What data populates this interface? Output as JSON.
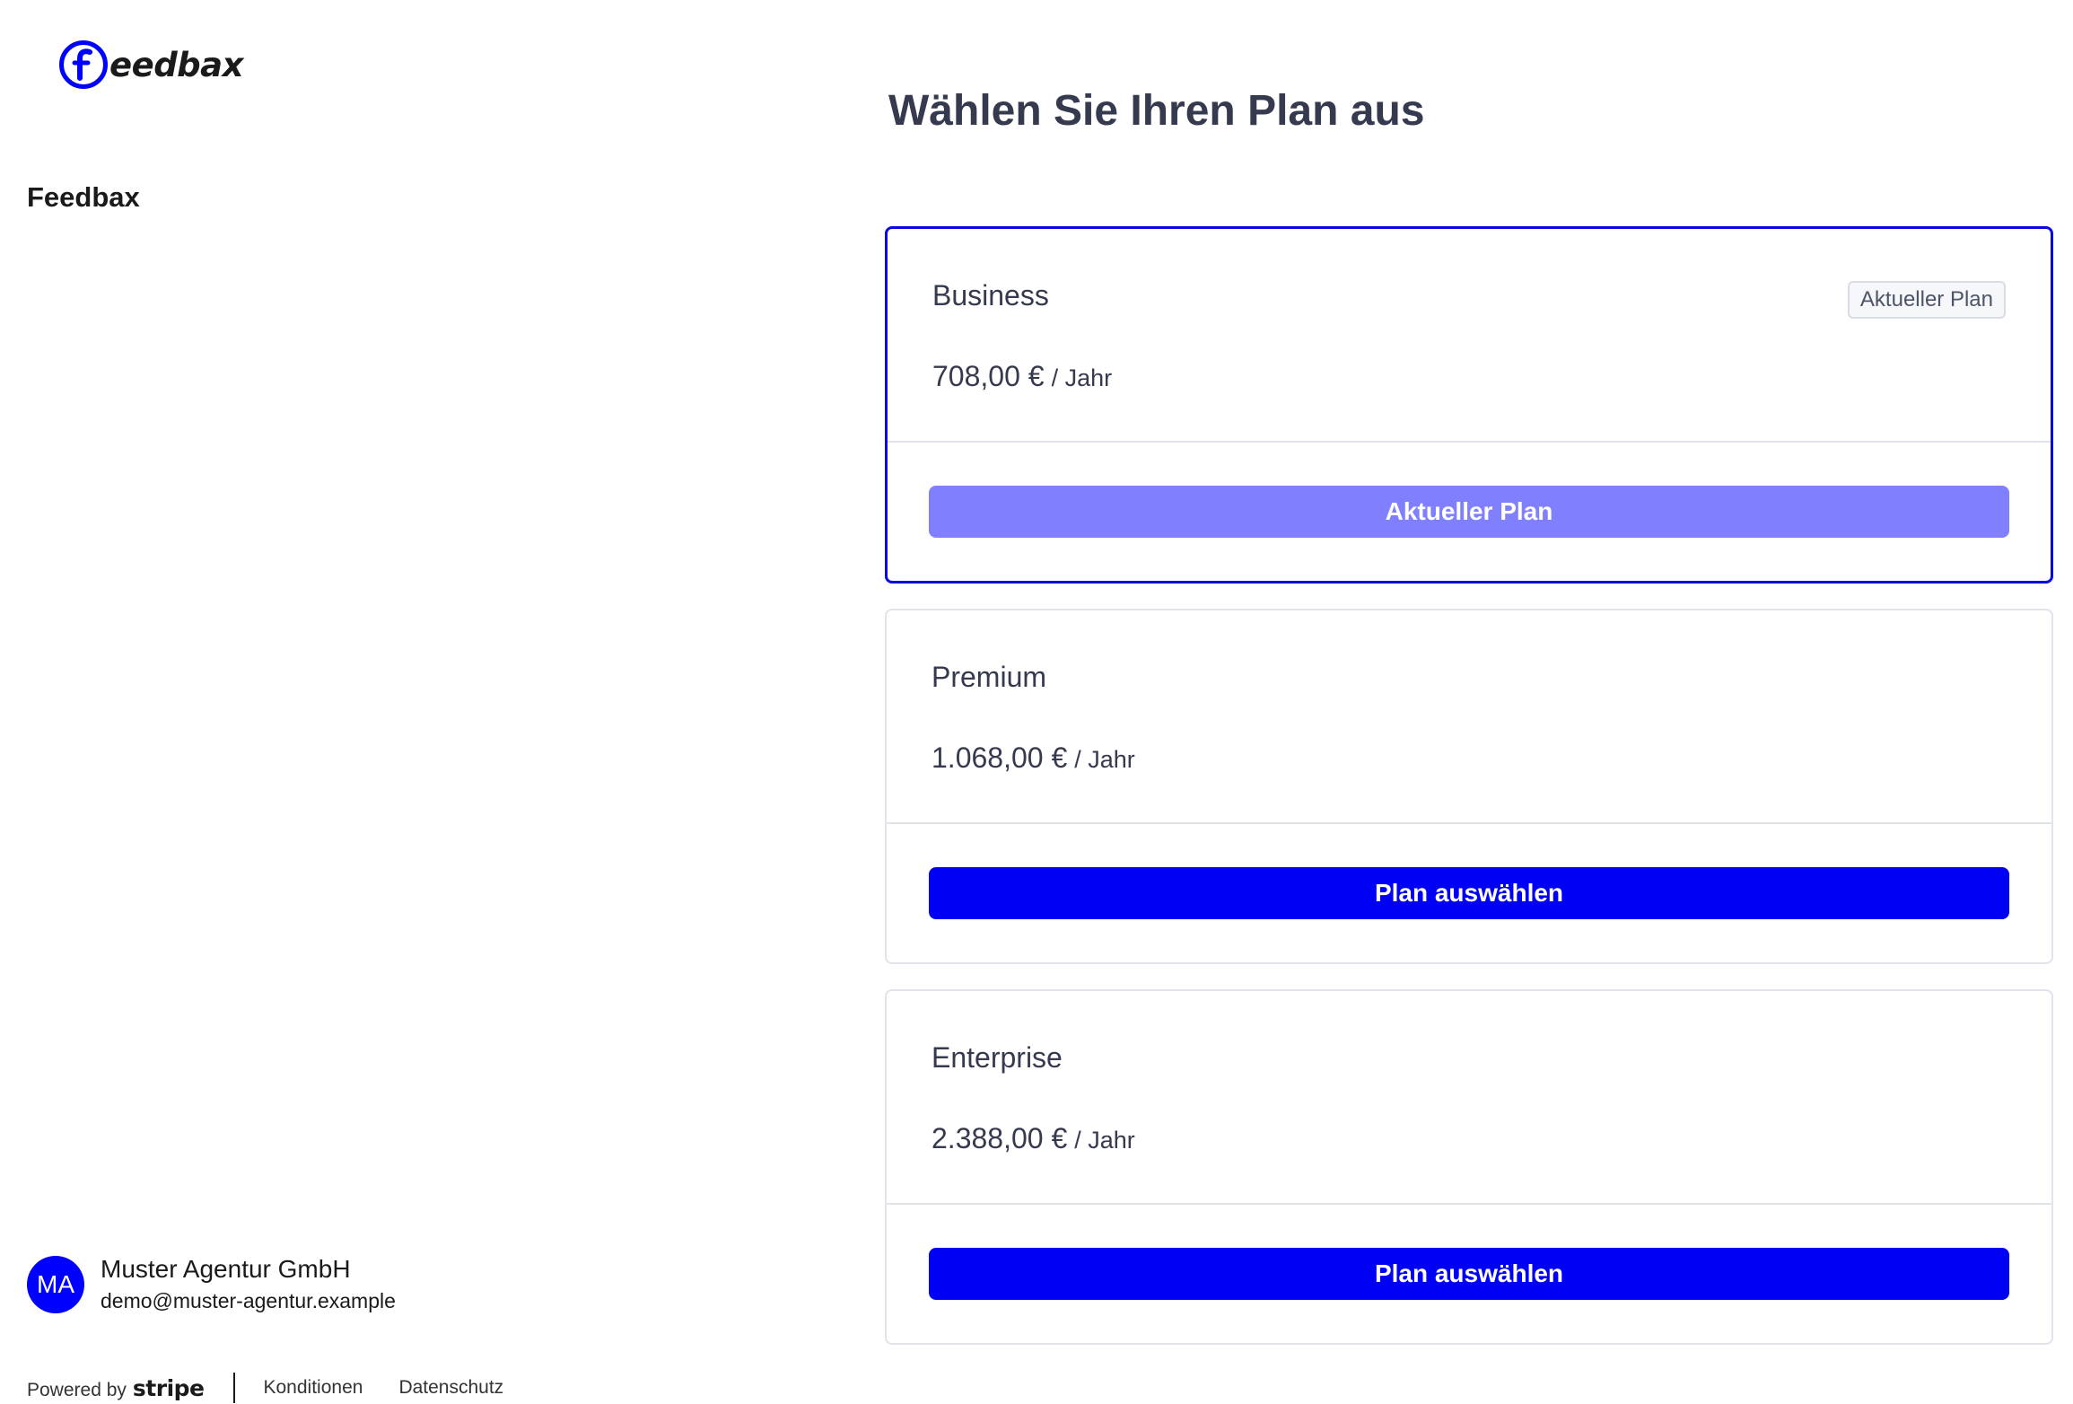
{
  "brand": {
    "logo_text": "eedbax",
    "logo_mark_letter": "f"
  },
  "sidebar": {
    "company": "Feedbax",
    "account": {
      "initials": "MA",
      "name": "Muster Agentur GmbH",
      "email": "demo@muster-agentur.example"
    },
    "footer": {
      "powered_by": "Powered by",
      "stripe": "stripe",
      "links": [
        "Konditionen",
        "Datenschutz"
      ]
    }
  },
  "main": {
    "title": "Wählen Sie Ihren Plan aus",
    "plans": [
      {
        "name": "Business",
        "price": "708,00 €",
        "period": "/ Jahr",
        "badge": "Aktueller Plan",
        "button": "Aktueller Plan",
        "current": true
      },
      {
        "name": "Premium",
        "price": "1.068,00 €",
        "period": "/ Jahr",
        "button": "Plan auswählen",
        "current": false
      },
      {
        "name": "Enterprise",
        "price": "2.388,00 €",
        "period": "/ Jahr",
        "button": "Plan auswählen",
        "current": false
      }
    ]
  },
  "colors": {
    "accent": "#0000f5",
    "accent_disabled": "#8080ff",
    "title": "#353a4f",
    "card_border": "#e1e4ea"
  }
}
